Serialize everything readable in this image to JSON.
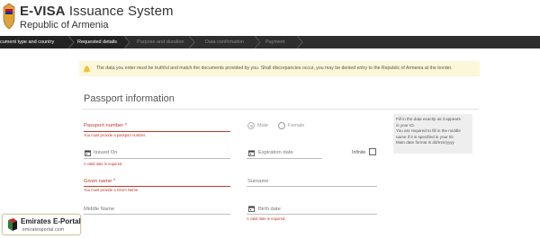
{
  "header": {
    "title_bold": "E-VISA",
    "title_rest": " Issuance System",
    "subtitle": "Republic of Armenia"
  },
  "steps": [
    {
      "label": "cument type and country",
      "state": "done"
    },
    {
      "label": "Requested details",
      "state": "active"
    },
    {
      "label": "Purpose and duration",
      "state": "inactive"
    },
    {
      "label": "Data confirmation",
      "state": "inactive"
    },
    {
      "label": "Payment",
      "state": "inactive"
    }
  ],
  "notice": {
    "text": "The data you enter must be truthful and match the documents provided by you. Shall discrepancies occur, you may be denied entry to the Republic of Armenia at the border.",
    "accent": "#f2c037"
  },
  "section": {
    "title": "Passport information"
  },
  "fields": {
    "passport_number": {
      "label": "Passport number *",
      "error": "You must provide a passport number."
    },
    "issued_on": {
      "label": "Issued On",
      "error": "A valid date is required."
    },
    "expiration_date": {
      "label": "Expiration date"
    },
    "infinite": {
      "label": "Infinite",
      "checked": false
    },
    "given_name": {
      "label": "Given name *",
      "error": "You must provide a Given Name."
    },
    "surname": {
      "label": "Surname"
    },
    "middle_name": {
      "label": "Middle Name"
    },
    "birth_date": {
      "label": "Birth date",
      "error": "A valid date is required."
    }
  },
  "gender": {
    "options": [
      "Male",
      "Female"
    ],
    "selected": "Male"
  },
  "help": {
    "lines": [
      "Fill in the data exactly as it appears",
      "in your ID.",
      "You are required to fill in the middle",
      "name if it is specified in your ID.",
      "Main date format is dd/mm/yyyy"
    ]
  },
  "watermark": {
    "title": "Emirates E-Portal",
    "subtitle": "emiratesportal.com"
  },
  "colors": {
    "error": "#c0392b",
    "steps_bar": "#2e2e2e",
    "notice_bg": "#fcf7d9"
  }
}
